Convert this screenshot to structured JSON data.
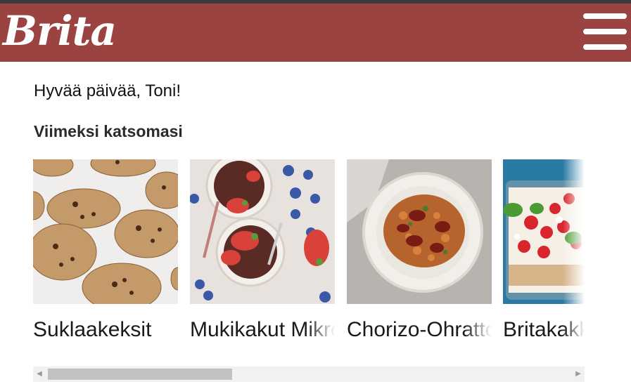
{
  "header": {
    "logo": "Brita",
    "brand_color": "#9b4341",
    "menu_icon": "hamburger-menu-icon"
  },
  "greeting": "Hyvää päivää, Toni!",
  "recent": {
    "title": "Viimeksi katsomasi",
    "items": [
      {
        "label": "Suklaakeksit",
        "image": "chocolate-chip-cookies"
      },
      {
        "label": "Mukikakut Mikro",
        "image": "mug-cakes-with-berries"
      },
      {
        "label": "Chorizo-Ohratto",
        "image": "chorizo-barley-risotto"
      },
      {
        "label": "Britakakku",
        "image": "brita-cake-with-strawberries"
      }
    ]
  },
  "scrollbar": {
    "left_icon": "scroll-left-arrow-icon",
    "right_icon": "scroll-right-arrow-icon"
  }
}
